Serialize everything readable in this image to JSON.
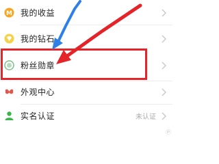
{
  "menu": {
    "items": [
      {
        "label": "我的收益",
        "icon": "coin-icon",
        "icon_color": "#f5a623"
      },
      {
        "label": "我的钻石",
        "icon": "diamond-icon",
        "icon_color": "#f0c419"
      },
      {
        "label": "粉丝勋章",
        "icon": "medal-icon",
        "icon_color": "#7bbf8a",
        "highlighted": true
      },
      {
        "label": "外观中心",
        "icon": "butterfly-icon",
        "icon_color": "#e2574c"
      },
      {
        "label": "实名认证",
        "value": "未认证",
        "icon": "user-icon",
        "icon_color": "#3bb54a"
      }
    ]
  },
  "annotations": {
    "highlight_color": "#e5242a",
    "arrow_red_color": "#e5242a",
    "arrow_blue_color": "#2f7fe8"
  },
  "watermark": "Ⓟ"
}
